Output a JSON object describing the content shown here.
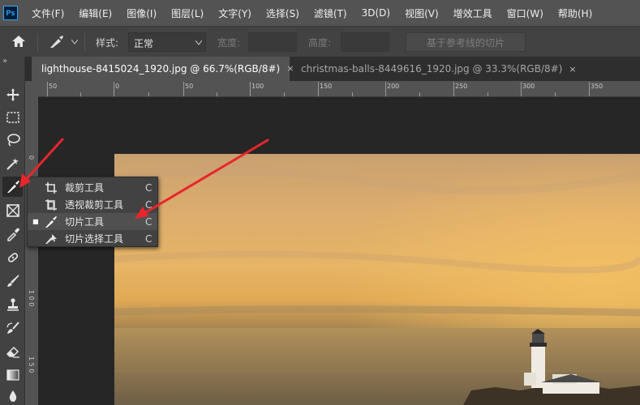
{
  "app": {
    "logo": "Ps"
  },
  "menu": [
    "文件(F)",
    "编辑(E)",
    "图像(I)",
    "图层(L)",
    "文字(Y)",
    "选择(S)",
    "滤镜(T)",
    "3D(D)",
    "视图(V)",
    "增效工具",
    "窗口(W)",
    "帮助(H)"
  ],
  "options": {
    "style_label": "样式:",
    "style_value": "正常",
    "width_label": "宽度:",
    "height_label": "高度:",
    "guides_button": "基于参考线的切片"
  },
  "toolbar": {
    "collapse": "»",
    "tools": [
      "move-icon",
      "marquee-icon",
      "lasso-icon",
      "magic-wand-icon",
      "slice-icon",
      "frame-icon",
      "eyedropper-icon",
      "healing-brush-icon",
      "brush-icon",
      "stamp-icon",
      "history-brush-icon",
      "eraser-icon",
      "gradient-icon",
      "blur-icon"
    ]
  },
  "tabs": [
    {
      "title": "lighthouse-8415024_1920.jpg @ 66.7%(RGB/8#)",
      "close": "×",
      "active": true
    },
    {
      "title": "christmas-balls-8449616_1920.jpg @ 33.3%(RGB/8#)",
      "close": "×",
      "active": false
    }
  ],
  "ruler": {
    "h_labels": [
      "50",
      "0",
      "50",
      "100",
      "150",
      "200",
      "250",
      "300",
      "350"
    ],
    "v_labels": [
      "0",
      "5",
      "1 0 0",
      "1 5 0"
    ]
  },
  "flyout": {
    "items": [
      {
        "label": "裁剪工具",
        "shortcut": "C",
        "icon": "crop-icon",
        "selected": false
      },
      {
        "label": "透视裁剪工具",
        "shortcut": "C",
        "icon": "perspective-crop-icon",
        "selected": false
      },
      {
        "label": "切片工具",
        "shortcut": "C",
        "icon": "slice-icon",
        "selected": true
      },
      {
        "label": "切片选择工具",
        "shortcut": "C",
        "icon": "slice-select-icon",
        "selected": false
      }
    ],
    "selected_marker": "■"
  },
  "colors": {
    "annotation_arrow": "#e8262b",
    "menubar": "#535353",
    "panel": "#424242"
  }
}
